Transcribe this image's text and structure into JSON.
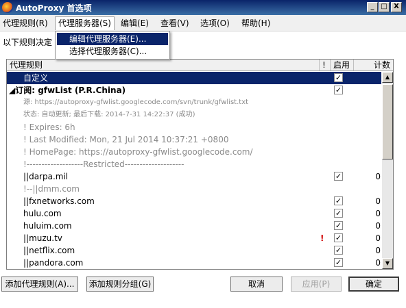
{
  "window": {
    "title": "AutoProxy 首选项",
    "controls": {
      "minimize": "_",
      "maximize": "□",
      "close": "X"
    }
  },
  "menubar": {
    "items": [
      {
        "label": "代理规则(R)"
      },
      {
        "label": "代理服务器(S)"
      },
      {
        "label": "编辑(E)"
      },
      {
        "label": "查看(V)"
      },
      {
        "label": "选项(O)"
      },
      {
        "label": "帮助(H)"
      }
    ]
  },
  "dropdown": {
    "items": [
      {
        "label": "编辑代理服务器(E)...",
        "selected": true
      },
      {
        "label": "选择代理服务器(C)..."
      }
    ]
  },
  "description": "以下规则决定",
  "list": {
    "columns": {
      "rule": "代理规则",
      "warn": "!",
      "enabled": "启用",
      "count": "计数"
    },
    "rows": [
      {
        "text": "自定义",
        "selected": true,
        "checked": true,
        "count": ""
      },
      {
        "text": "◢订阅: gfwList (P.R.China)",
        "bold": true,
        "checked": true,
        "count": ""
      },
      {
        "text": "源:   https://autoproxy-gfwlist.googlecode.com/svn/trunk/gfwlist.txt",
        "grey": true,
        "small": true
      },
      {
        "text": "状态:   自动更新; 最后下载: 2014-7-31 14:22:37 (成功)",
        "grey": true,
        "small": true
      },
      {
        "text": "! Expires: 6h",
        "grey": true
      },
      {
        "text": "! Last Modified: Mon, 21 Jul 2014 10:37:21 +0800",
        "grey": true
      },
      {
        "text": "! HomePage: https://autoproxy-gfwlist.googlecode.com/",
        "grey": true
      },
      {
        "text": "!-------------------Restricted--------------------",
        "grey": true
      },
      {
        "text": "||darpa.mil",
        "checked": true,
        "count": "0"
      },
      {
        "text": "!--||dmm.com",
        "grey": true
      },
      {
        "text": "||fxnetworks.com",
        "checked": true,
        "count": "0"
      },
      {
        "text": "hulu.com",
        "checked": true,
        "count": "0"
      },
      {
        "text": "huluim.com",
        "checked": true,
        "count": "0"
      },
      {
        "text": "||muzu.tv",
        "warn": "!",
        "checked": true,
        "count": "0"
      },
      {
        "text": "||netflix.com",
        "checked": true,
        "count": "0"
      },
      {
        "text": "||pandora.com",
        "checked": true,
        "count": "0"
      }
    ]
  },
  "buttons": {
    "add_rule": "添加代理规则(A)...",
    "add_group": "添加规则分组(G)",
    "cancel": "取消",
    "apply": "应用(P)",
    "ok": "确定"
  }
}
